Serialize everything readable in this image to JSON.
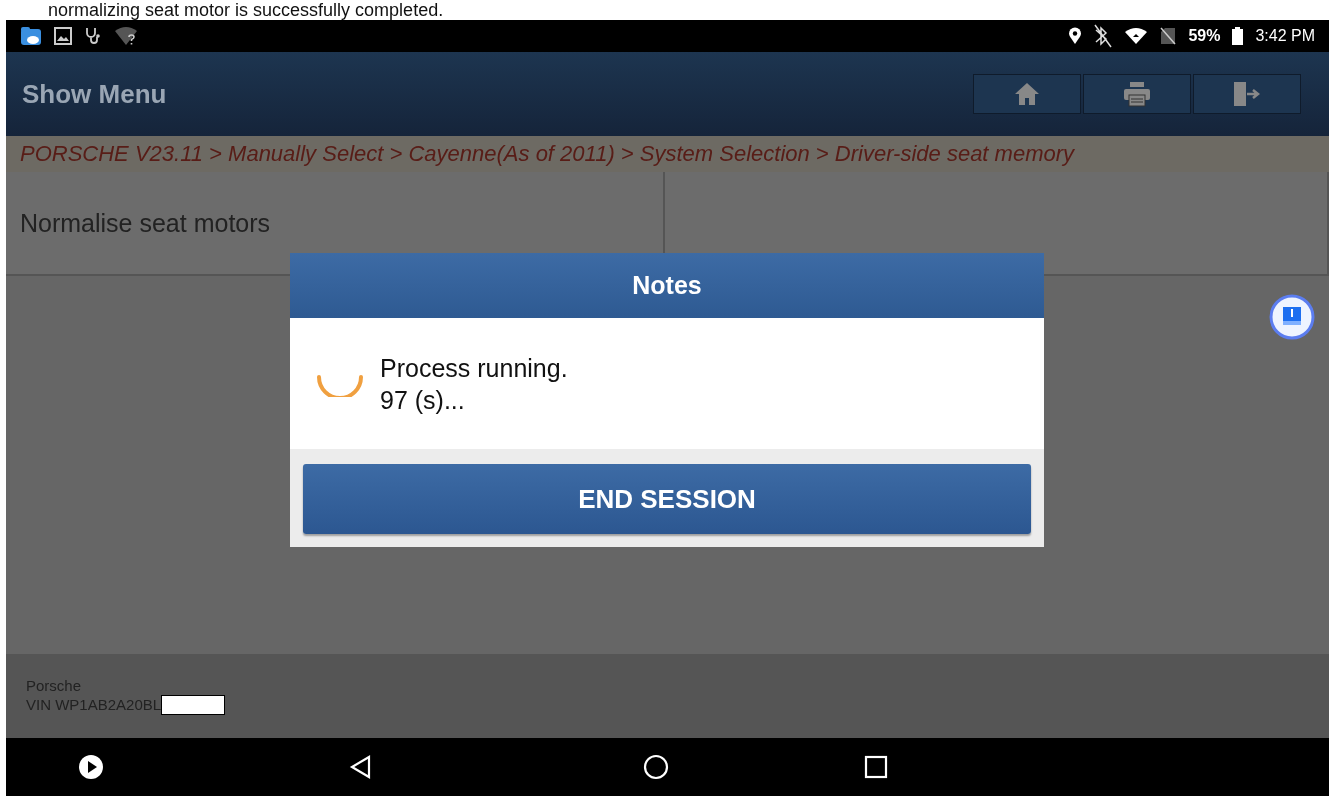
{
  "caption": "normalizing seat motor is successfully completed.",
  "status_bar": {
    "battery_percent": "59%",
    "time": "3:42 PM"
  },
  "header": {
    "title": "Show Menu"
  },
  "breadcrumb": "PORSCHE V23.11 > Manually Select > Cayenne(As of 2011) > System Selection > Driver-side seat memory",
  "table": {
    "rows": [
      {
        "cells": [
          "Normalise seat motors",
          ""
        ]
      }
    ]
  },
  "dialog": {
    "title": "Notes",
    "lines": [
      "Process running.",
      "97 (s)..."
    ],
    "button": "END SESSION"
  },
  "footer": {
    "make": "Porsche",
    "vin": "VIN WP1AB2A20BL"
  }
}
